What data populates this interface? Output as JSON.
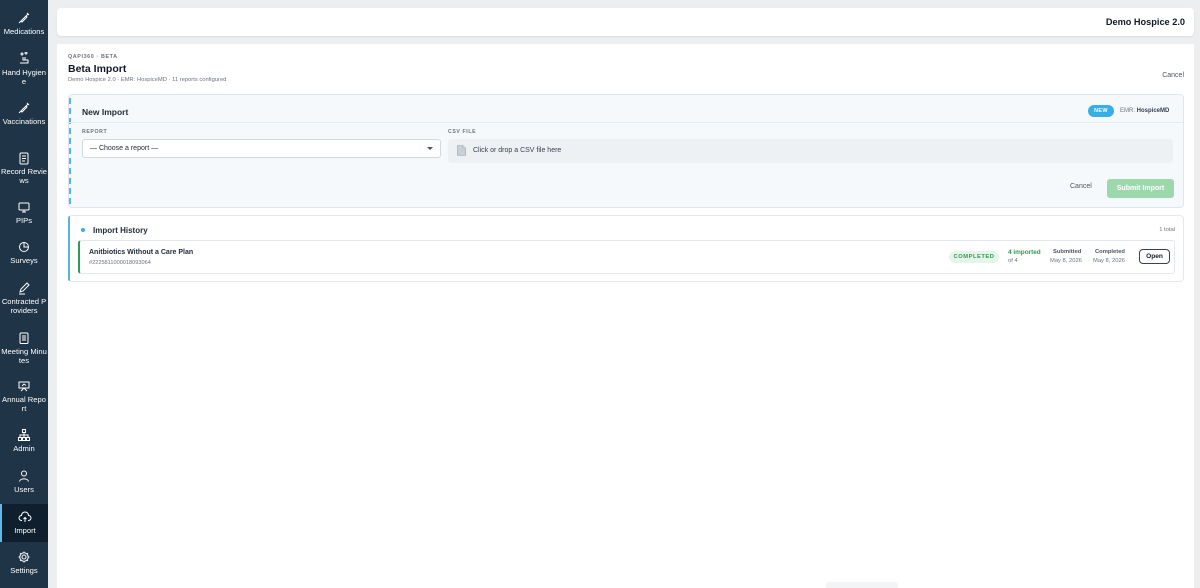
{
  "sidebar": {
    "items": [
      {
        "label": "Medications",
        "icon": "syringe-icon"
      },
      {
        "label": "Hand Hygiene",
        "icon": "hand-wash-icon"
      },
      {
        "label": "Vaccinations",
        "icon": "syringe-icon"
      },
      {
        "label": "Record Reviews",
        "icon": "clipboard-icon"
      },
      {
        "label": "PIPs",
        "icon": "monitor-icon"
      },
      {
        "label": "Surveys",
        "icon": "pie-chart-icon"
      },
      {
        "label": "Contracted Providers",
        "icon": "pen-icon"
      },
      {
        "label": "Meeting Minutes",
        "icon": "notes-icon"
      },
      {
        "label": "Annual Report",
        "icon": "presentation-icon"
      },
      {
        "label": "Admin",
        "icon": "org-chart-icon"
      },
      {
        "label": "Users",
        "icon": "user-icon"
      },
      {
        "label": "Import",
        "icon": "cloud-upload-icon",
        "active": true
      },
      {
        "label": "Settings",
        "icon": "gear-icon"
      }
    ]
  },
  "header": {
    "org_name": "Demo Hospice 2.0"
  },
  "page": {
    "eyebrow": "QAPI360 · BETA",
    "title": "Beta Import",
    "subtitle": "Demo Hospice 2.0 · EMR: HospiceMD · 11 reports configured",
    "cancel_label": "Cancel"
  },
  "new_import": {
    "title": "New Import",
    "badge": "NEW",
    "emr_label": "EMR:",
    "emr_value": "HospiceMD",
    "report_label": "REPORT",
    "report_value": "— Choose a report —",
    "csv_label": "CSV FILE",
    "csv_placeholder": "Click or drop a CSV file here",
    "cancel_label": "Cancel",
    "submit_label": "Submit Import"
  },
  "history": {
    "title": "Import History",
    "total": "1 total",
    "rows": [
      {
        "name": "Anitbiotics Without a Care Plan",
        "id": "#2225811000018093064",
        "status": "COMPLETED",
        "imported": "4 imported",
        "of": "of 4",
        "submitted_label": "Submitted",
        "submitted_date": "May 8, 2026",
        "completed_label": "Completed",
        "completed_date": "May 8, 2026",
        "open_label": "Open"
      }
    ]
  },
  "colors": {
    "sidebar_bg": "#1f3447",
    "accent_blue": "#36aee6",
    "success_green": "#2e9a52",
    "submit_disabled": "#9dd8ad"
  }
}
